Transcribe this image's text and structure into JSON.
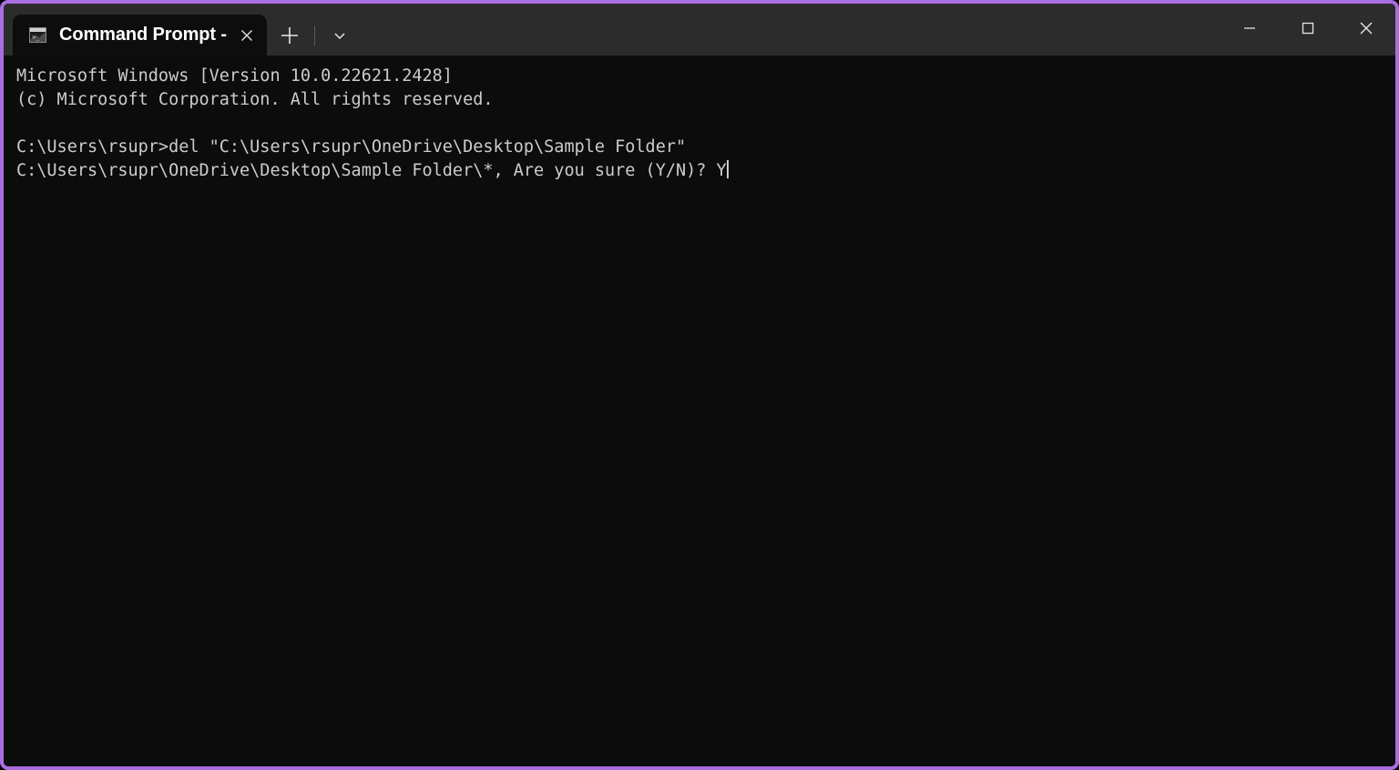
{
  "window": {
    "accent_color": "#a96ee0",
    "titlebar_color": "#2c2c2c",
    "terminal_bg": "#0c0c0c",
    "terminal_fg": "#cccccc"
  },
  "titlebar": {
    "tab": {
      "title": "Command Prompt -",
      "icon": "console-icon",
      "close_label": "×"
    },
    "new_tab_label": "+",
    "dropdown_label": "⌄",
    "controls": {
      "minimize_label": "–",
      "maximize_label": "□",
      "close_label": "×"
    }
  },
  "terminal": {
    "lines": [
      "Microsoft Windows [Version 10.0.22621.2428]",
      "(c) Microsoft Corporation. All rights reserved.",
      "",
      "C:\\Users\\rsupr>del \"C:\\Users\\rsupr\\OneDrive\\Desktop\\Sample Folder\"",
      "C:\\Users\\rsupr\\OneDrive\\Desktop\\Sample Folder\\*, Are you sure (Y/N)? Y"
    ],
    "prompt_path": "C:\\Users\\rsupr>",
    "command": "del \"C:\\Users\\rsupr\\OneDrive\\Desktop\\Sample Folder\"",
    "confirmation_prompt": "C:\\Users\\rsupr\\OneDrive\\Desktop\\Sample Folder\\*, Are you sure (Y/N)?",
    "typed_answer": "Y"
  }
}
